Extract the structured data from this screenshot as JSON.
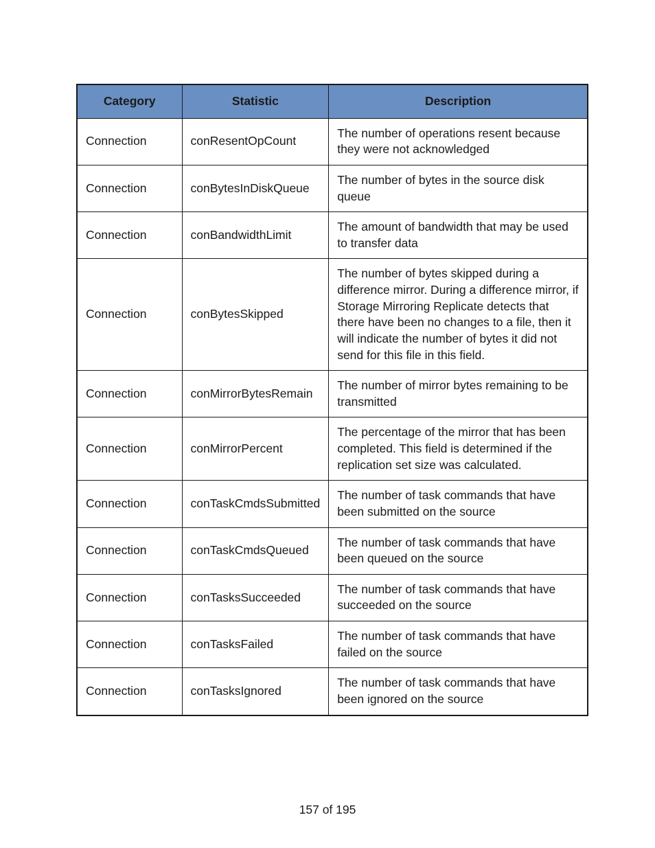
{
  "table": {
    "headers": {
      "category": "Category",
      "statistic": "Statistic",
      "description": "Description"
    },
    "rows": [
      {
        "category": "Connection",
        "statistic": "conResentOpCount",
        "description": "The number of operations resent because they were not acknowledged"
      },
      {
        "category": "Connection",
        "statistic": "conBytesInDiskQueue",
        "description": "The number of bytes in the source disk queue"
      },
      {
        "category": "Connection",
        "statistic": "conBandwidthLimit",
        "description": "The amount of bandwidth that may be used to transfer data"
      },
      {
        "category": "Connection",
        "statistic": "conBytesSkipped",
        "description": "The number of bytes skipped during a difference mirror. During a difference mirror, if Storage Mirroring Replicate detects that there have been no changes to a file, then it will indicate the number of bytes it did not send for this file in this field."
      },
      {
        "category": "Connection",
        "statistic": "conMirrorBytesRemain",
        "description": "The number of mirror bytes remaining to be transmitted"
      },
      {
        "category": "Connection",
        "statistic": "conMirrorPercent",
        "description": "The percentage of the mirror that has been completed. This field is determined if the replication set size was calculated."
      },
      {
        "category": "Connection",
        "statistic": "conTaskCmdsSubmitted",
        "description": "The number of task commands that have been submitted on the source"
      },
      {
        "category": "Connection",
        "statistic": "conTaskCmdsQueued",
        "description": "The number of task commands that have been queued on the source"
      },
      {
        "category": "Connection",
        "statistic": "conTasksSucceeded",
        "description": "The number of task commands that have succeeded on the source"
      },
      {
        "category": "Connection",
        "statistic": "conTasksFailed",
        "description": "The number of task commands that have failed on the source"
      },
      {
        "category": "Connection",
        "statistic": "conTasksIgnored",
        "description": "The number of task commands that have been ignored on the source"
      }
    ]
  },
  "pageNumber": "157 of 195"
}
